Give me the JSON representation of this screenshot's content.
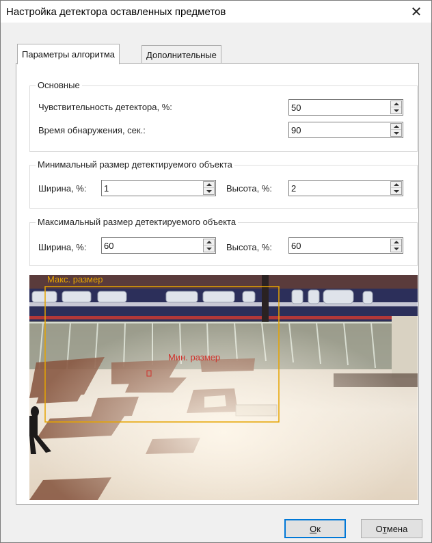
{
  "window": {
    "title": "Настройка детектора оставленных предметов",
    "close_glyph": "✕"
  },
  "tabs": [
    {
      "label": "Параметры алгоритма",
      "active": true
    },
    {
      "label": "Дополнительные",
      "active": false
    }
  ],
  "basic": {
    "legend": "Основные",
    "sensitivity_label": "Чувствительность детектора, %:",
    "sensitivity_value": "50",
    "detection_time_label": "Время обнаружения, сек.:",
    "detection_time_value": "90"
  },
  "min_size": {
    "legend": "Минимальный размер детектируемого объекта",
    "width_label": "Ширина, %:",
    "width_value": "1",
    "height_label": "Высота, %:",
    "height_value": "2"
  },
  "max_size": {
    "legend": "Максимальный размер детектируемого объекта",
    "width_label": "Ширина, %:",
    "width_value": "60",
    "height_label": "Высота, %:",
    "height_value": "60"
  },
  "preview": {
    "max_label": "Макс. размер",
    "min_label": "Мин. размер",
    "max_color": "#e6a400",
    "min_color": "#d0302a"
  },
  "buttons": {
    "ok_hotkey": "О",
    "ok_rest": "к",
    "cancel_prefix": "О",
    "cancel_hotkey": "т",
    "cancel_rest": "мена"
  }
}
